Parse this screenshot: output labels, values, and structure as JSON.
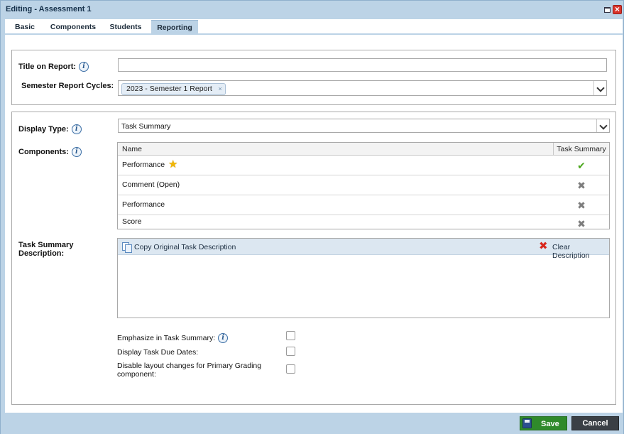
{
  "window": {
    "title": "Editing - Assessment 1"
  },
  "tabs": [
    {
      "label": "Basic"
    },
    {
      "label": "Components"
    },
    {
      "label": "Students"
    },
    {
      "label": "Reporting",
      "active": true
    }
  ],
  "report": {
    "title_label": "Title on Report:",
    "title_value": "",
    "cycles_label": "Semester Report Cycles:",
    "cycles_selected": [
      "2023 - Semester 1 Report"
    ],
    "cycles_remove_glyph": "×"
  },
  "display": {
    "type_label": "Display Type:",
    "type_value": "Task Summary",
    "components_label": "Components:",
    "grid": {
      "headers": [
        "Name",
        "Task Summary"
      ],
      "rows": [
        {
          "name": "Performance",
          "starred": true,
          "task_summary": true
        },
        {
          "name": "Comment (Open)",
          "starred": false,
          "task_summary": false
        },
        {
          "name": "Performance",
          "starred": false,
          "task_summary": false
        },
        {
          "name": "Score",
          "starred": false,
          "task_summary": false
        }
      ]
    },
    "description_label_line1": "Task Summary",
    "description_label_line2": "Description:",
    "copy_label": "Copy Original Task Description",
    "clear_label": "Clear Description"
  },
  "options": [
    {
      "label": "Emphasize in Task Summary:",
      "checked": false,
      "has_info": true
    },
    {
      "label": "Display Task Due Dates:",
      "checked": false,
      "has_info": false
    },
    {
      "label_line1": "Disable layout changes for Primary Grading",
      "label_line2": "component:",
      "checked": false,
      "has_info": false
    }
  ],
  "footer": {
    "save_label": "Save",
    "cancel_label": "Cancel"
  },
  "icons": {
    "info": "info-icon",
    "star": "star-icon",
    "check": "check-icon",
    "x": "x-icon",
    "copy": "copy-icon",
    "clear": "clear-icon",
    "save": "save-icon"
  },
  "colors": {
    "chrome": "#bcd3e6",
    "save_button": "#2f8a2b",
    "cancel_button": "#3a3f45",
    "check": "#4aa61c",
    "clear": "#d8261c",
    "star": "#f2b705"
  }
}
